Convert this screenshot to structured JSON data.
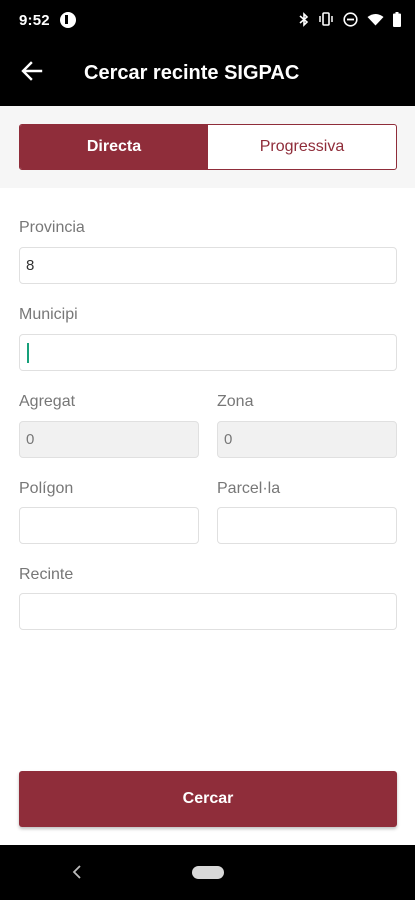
{
  "status_bar": {
    "time": "9:52",
    "icons": [
      "bluetooth-icon",
      "vibrate-icon",
      "do-not-disturb-icon",
      "wifi-icon",
      "battery-icon"
    ]
  },
  "app_bar": {
    "title": "Cercar recinte SIGPAC",
    "back_icon": "arrow-left-icon"
  },
  "segments": {
    "active": "Directa",
    "inactive": "Progressiva"
  },
  "form": {
    "provincia": {
      "label": "Provincia",
      "value": "8"
    },
    "municipi": {
      "label": "Municipi",
      "value": ""
    },
    "agregat": {
      "label": "Agregat",
      "value": "0"
    },
    "zona": {
      "label": "Zona",
      "value": "0"
    },
    "poligon": {
      "label": "Polígon",
      "value": ""
    },
    "parcela": {
      "label": "Parcel·la",
      "value": ""
    },
    "recinte": {
      "label": "Recinte",
      "value": ""
    }
  },
  "submit_label": "Cercar",
  "colors": {
    "accent": "#8f2d3a",
    "bar": "#000000",
    "caret": "#17a07a"
  }
}
